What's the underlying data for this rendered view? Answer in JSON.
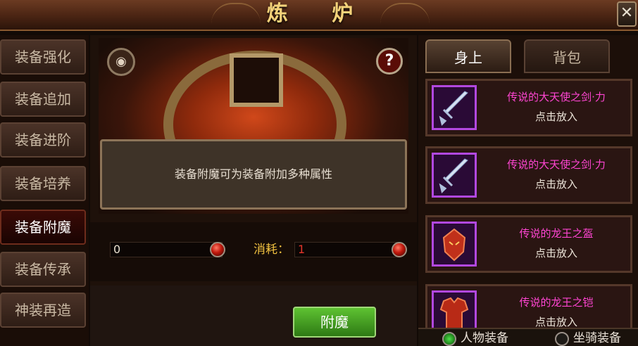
{
  "window": {
    "title": "炼 炉",
    "close_glyph": "✕"
  },
  "nav": {
    "items": [
      {
        "label": "装备强化",
        "active": false
      },
      {
        "label": "装备追加",
        "active": false
      },
      {
        "label": "装备进阶",
        "active": false
      },
      {
        "label": "装备培养",
        "active": false
      },
      {
        "label": "装备附魔",
        "active": true
      },
      {
        "label": "装备传承",
        "active": false
      },
      {
        "label": "神装再造",
        "active": false
      }
    ]
  },
  "forge": {
    "eye_icon": "eye-icon",
    "help_glyph": "?",
    "description": "装备附魔可为装备附加多种属性",
    "owned_value": "0",
    "cost_label": "消耗：",
    "cost_value": "1",
    "enchant_button": "附魔"
  },
  "right": {
    "tabs": [
      {
        "label": "身上",
        "active": true
      },
      {
        "label": "背包",
        "active": false
      }
    ],
    "items": [
      {
        "name": "传说的大天使之剑·力",
        "action": "点击放入",
        "icon": "sword-icon"
      },
      {
        "name": "传说的大天使之剑·力",
        "action": "点击放入",
        "icon": "sword-icon"
      },
      {
        "name": "传说的龙王之盔",
        "action": "点击放入",
        "icon": "helmet-icon"
      },
      {
        "name": "传说的龙王之铠",
        "action": "点击放入",
        "icon": "armor-icon"
      }
    ],
    "filters": [
      {
        "label": "人物装备",
        "selected": true
      },
      {
        "label": "坐骑装备",
        "selected": false
      }
    ]
  },
  "colors": {
    "item_name": "#ff45d2",
    "cost_value": "#e4352a",
    "accent_gold": "#f4d27a",
    "button_green": "#5ec232"
  }
}
